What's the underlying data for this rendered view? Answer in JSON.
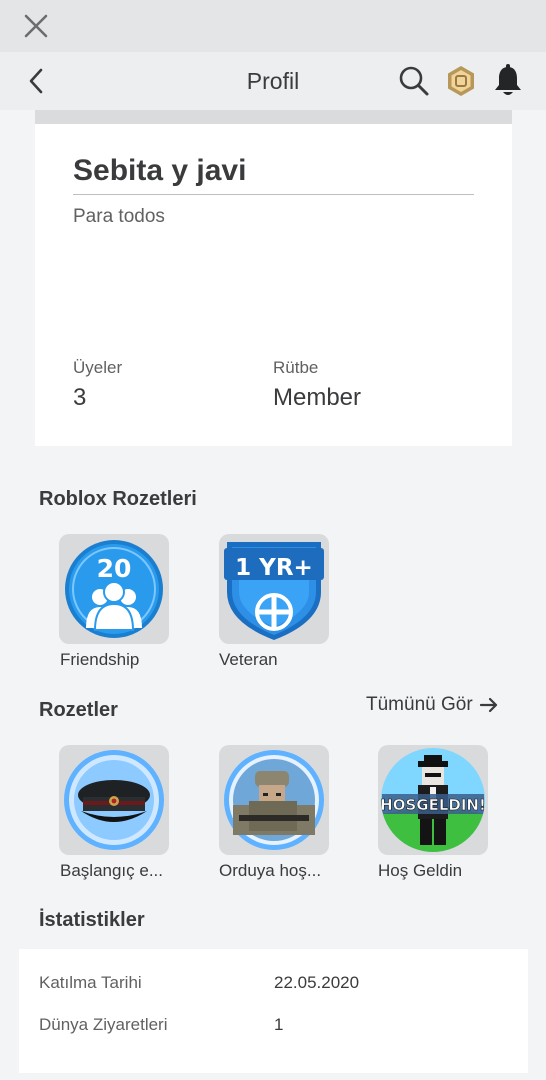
{
  "nav": {
    "title": "Profil"
  },
  "group": {
    "name": "Sebita y javi",
    "description": "Para todos",
    "members_label": "Üyeler",
    "members_value": "3",
    "rank_label": "Rütbe",
    "rank_value": "Member"
  },
  "roblox_badges": {
    "title": "Roblox Rozetleri",
    "items": [
      {
        "label": "Friendship",
        "icon": "friendship-badge-icon",
        "number": "20"
      },
      {
        "label": "Veteran",
        "icon": "veteran-badge-icon",
        "text": "1 YR+"
      }
    ]
  },
  "badges": {
    "title": "Rozetler",
    "see_all": "Tümünü Gör",
    "items": [
      {
        "label": "Başlangıç e..."
      },
      {
        "label": "Orduya hoş..."
      },
      {
        "label": "Hoş Geldin",
        "banner": "HOSGELDIN!"
      }
    ]
  },
  "stats": {
    "title": "İstatistikler",
    "rows": [
      {
        "label": "Katılma Tarihi",
        "value": "22.05.2020"
      },
      {
        "label": "Dünya Ziyaretleri",
        "value": "1"
      }
    ]
  },
  "colors": {
    "background": "#f2f4f5",
    "badge_blue": "#1d8fe4",
    "text": "#393b3d"
  }
}
